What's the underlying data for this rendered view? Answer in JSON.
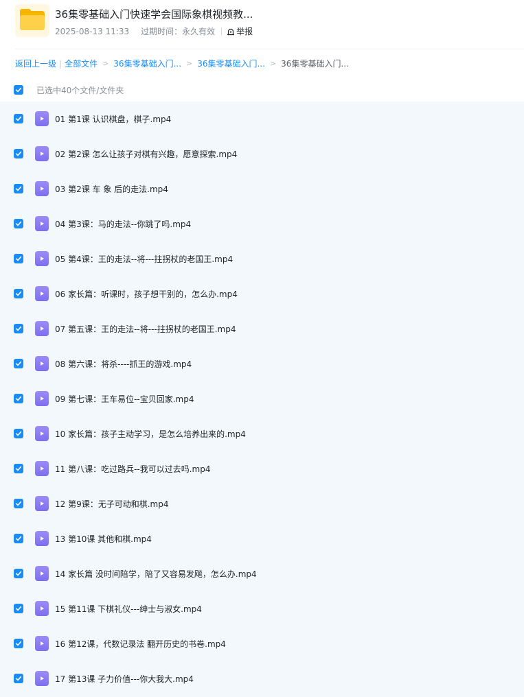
{
  "header": {
    "title": "36集零基础入门快速学会国际象棋视频教...",
    "date": "2025-08-13 11:33",
    "expire_label": "过期时间：永久有效",
    "report_label": "举报"
  },
  "breadcrumb": {
    "back": "返回上一级",
    "separator": "|",
    "items": [
      {
        "label": "全部文件"
      },
      {
        "label": "36集零基础入门..."
      },
      {
        "label": "36集零基础入门..."
      }
    ],
    "current": "36集零基础入门...",
    "arrow": ">"
  },
  "selection": {
    "label": "已选中40个文件/文件夹",
    "checked": true
  },
  "files": [
    {
      "name": "01 第1课 认识棋盘，棋子.mp4"
    },
    {
      "name": "02 第2课 怎么让孩子对棋有兴趣，愿意探索.mp4"
    },
    {
      "name": "03 第2课 车 象 后的走法.mp4"
    },
    {
      "name": "04 第3课：马的走法--你跳了吗.mp4"
    },
    {
      "name": "05 第4课：王的走法--将---拄拐杖的老国王.mp4"
    },
    {
      "name": "06 家长篇：听课时，孩子想干别的，怎么办.mp4"
    },
    {
      "name": "07 第五课：王的走法--将---拄拐杖的老国王.mp4"
    },
    {
      "name": "08 第六课：将杀----抓王的游戏.mp4"
    },
    {
      "name": "09 第七课：王车易位--宝贝回家.mp4"
    },
    {
      "name": "10 家长篇：孩子主动学习，是怎么培养出来的.mp4"
    },
    {
      "name": "11 第八课：吃过路兵--我可以过去吗.mp4"
    },
    {
      "name": "12 第9课：无子可动和棋.mp4"
    },
    {
      "name": "13 第10课 其他和棋.mp4"
    },
    {
      "name": "14 家长篇 没时间陪学，陪了又容易发飚，怎么办.mp4"
    },
    {
      "name": "15 第11课 下棋礼仪---绅士与淑女.mp4"
    },
    {
      "name": "16 第12课，代数记录法 翻开历史的书卷.mp4"
    },
    {
      "name": "17 第13课 子力价值---你大我大.mp4"
    }
  ],
  "colors": {
    "accent": "#1b8cf2",
    "list_background": "#f3f8fd",
    "video_icon": "#8a7cf4",
    "folder": "#ffd04a"
  },
  "icons": {
    "folder": "folder-icon",
    "video": "video-file-icon",
    "check": "checkmark-icon",
    "report": "report-icon"
  }
}
